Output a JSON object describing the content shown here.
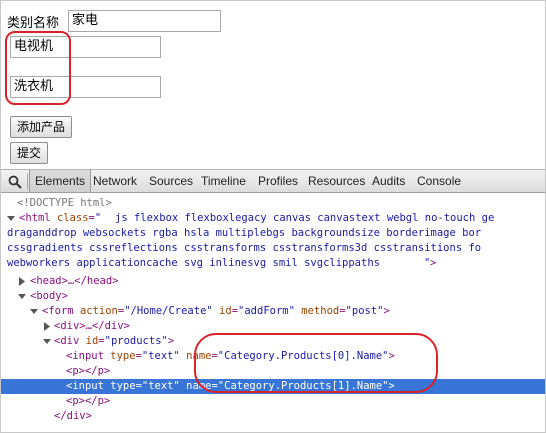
{
  "form": {
    "category_label": "类别名称",
    "category_value": "家电",
    "product_1_value": "电视机",
    "product_2_value": "洗衣机",
    "add_product_label": "添加产品",
    "submit_label": "提交"
  },
  "devtools": {
    "tabs": [
      "Elements",
      "Network",
      "Sources",
      "Timeline",
      "Profiles",
      "Resources",
      "Audits",
      "Console"
    ],
    "active_tab": "Elements",
    "html_classes_line1": "js flexbox flexboxlegacy canvas canvastext webgl no-touch ge",
    "html_classes_line2": "draganddrop websockets rgba hsla multiplebgs backgroundsize borderimage bor",
    "html_classes_line3": "cssgradients cssreflections csstransforms csstransforms3d csstransitions fo",
    "html_classes_line4": "webworkers applicationcache svg inlinesvg smil svgclippaths",
    "doctype": "<!DOCTYPE html>",
    "form_action": "/Home/Create",
    "form_id": "addForm",
    "form_method": "post",
    "products_div_id": "products",
    "input_type": "text",
    "input_name_0": "Category.Products[0].Name",
    "input_name_1": "Category.Products[1].Name"
  },
  "colors": {
    "annotation": "#d9232a",
    "selection": "#3875d7",
    "tag": "#881280",
    "attr_name": "#994500",
    "attr_value": "#1a1aa6"
  }
}
